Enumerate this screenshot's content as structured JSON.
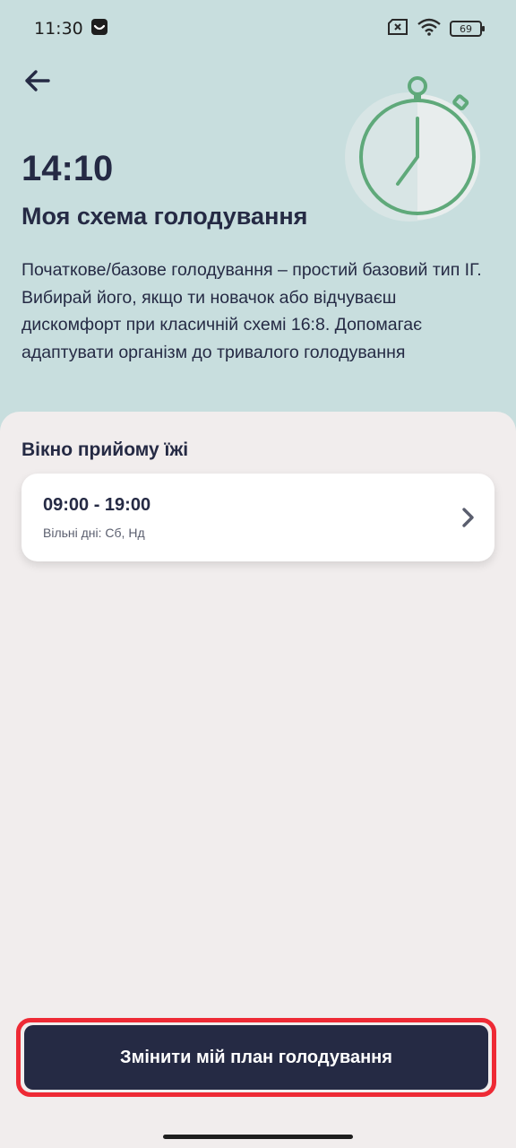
{
  "status_bar": {
    "time": "11:30",
    "battery": "69",
    "icons": [
      "app-notification-icon",
      "no-sim-icon",
      "wifi-icon",
      "battery-icon"
    ]
  },
  "header": {
    "time": "14:10",
    "title": "Моя схема голодування",
    "description": "Початкове/базове голодування – простий базовий тип ІГ. Вибирай його, якщо ти новачок або відчуваєш дискомфорт при класичній схемі 16:8. Допомагає адаптувати організм до тривалого голодування",
    "illustration": "stopwatch-icon"
  },
  "meal_window": {
    "section_title": "Вікно прийому їжі",
    "time_range": "09:00 - 19:00",
    "days_off": "Вільні дні: Сб, Нд"
  },
  "actions": {
    "change_plan_label": "Змінити мій план голодування"
  },
  "colors": {
    "header_bg": "#c8dede",
    "sheet_bg": "#f1eded",
    "primary": "#252a44",
    "accent_green": "#5fa97a",
    "highlight_red": "#ee2a35"
  }
}
